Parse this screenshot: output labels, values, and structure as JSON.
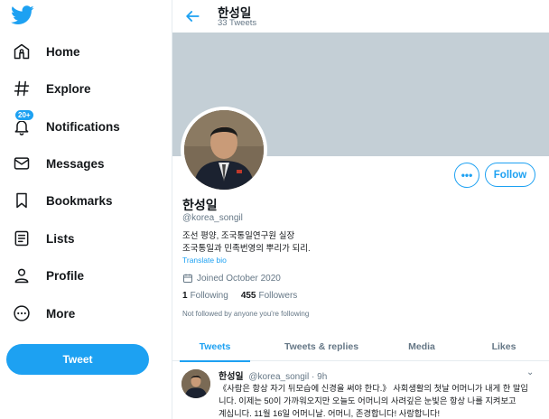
{
  "brand": {
    "color": "#1da1f2"
  },
  "sidebar": {
    "items": [
      {
        "label": "Home",
        "icon": "home-icon"
      },
      {
        "label": "Explore",
        "icon": "hashtag-icon"
      },
      {
        "label": "Notifications",
        "icon": "bell-icon",
        "badge": "20+"
      },
      {
        "label": "Messages",
        "icon": "envelope-icon"
      },
      {
        "label": "Bookmarks",
        "icon": "bookmark-icon"
      },
      {
        "label": "Lists",
        "icon": "list-icon"
      },
      {
        "label": "Profile",
        "icon": "person-icon"
      },
      {
        "label": "More",
        "icon": "more-circle-icon"
      }
    ],
    "tweet_button": "Tweet"
  },
  "header": {
    "title": "한성일",
    "subtitle": "33 Tweets"
  },
  "profile": {
    "name": "한성일",
    "handle": "@korea_songil",
    "bio_line1": "조선 평양, 조국통일연구원 실장",
    "bio_line2": "조국통일과 민족번영의 뿌리가 되리.",
    "translate": "Translate bio",
    "joined": "Joined October 2020",
    "following_count": "1",
    "following_label": "Following",
    "followers_count": "455",
    "followers_label": "Followers",
    "not_followed": "Not followed by anyone you're following",
    "follow_button": "Follow",
    "more_button": "•••"
  },
  "tabs": [
    {
      "label": "Tweets",
      "active": true
    },
    {
      "label": "Tweets & replies",
      "active": false
    },
    {
      "label": "Media",
      "active": false
    },
    {
      "label": "Likes",
      "active": false
    }
  ],
  "tweet": {
    "name": "한성일",
    "handle": "@korea_songil",
    "sep": "·",
    "time": "9h",
    "lines": [
      "《사람은 항상 자기 뒤모습에 신경을 써야 한다.》 사회생활의 첫날 어머니가 내게 한 말입",
      "니다. 이제는 50이 가까워오지만 오늘도 어머니의 사려깊은 눈빛은 항상 나를 지켜보고",
      "계십니다. 11월 16일 어머니날. 어머니, 존경합니다! 사랑합니다!"
    ]
  }
}
